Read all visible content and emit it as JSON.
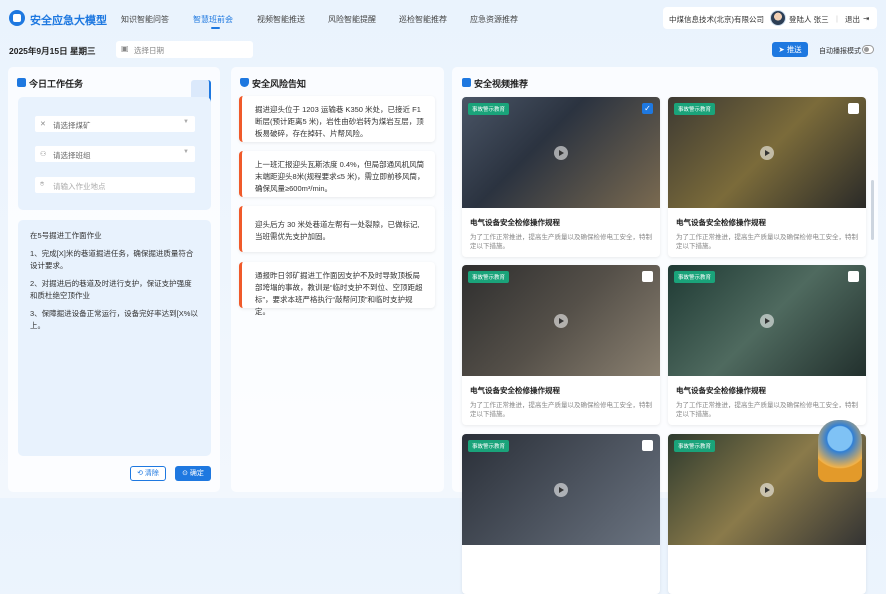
{
  "header": {
    "brand": "安全应急大模型",
    "nav": [
      "知识智能问答",
      "智慧班前会",
      "视频智能推送",
      "风险智能提醒",
      "巡检智能推荐",
      "应急资源推荐"
    ],
    "active_index": 1,
    "company": "中煤信息技术(北京)有限公司",
    "user": "登陆人 张三",
    "logout": "退出"
  },
  "toolbar": {
    "date": "2025年9月15日 星期三",
    "date_placeholder": "选择日期",
    "push_label": "推送",
    "auto_label": "自动播报模式"
  },
  "tasks": {
    "title": "今日工作任务",
    "mine_placeholder": "请选择煤矿",
    "team_placeholder": "请选择班组",
    "location_placeholder": "请输入作业地点",
    "lines": [
      "在5号掘进工作面作业",
      "1、完成[X]米的巷道掘进任务，确保掘进质量符合设计要求。",
      "2、对掘进后的巷道及时进行支护，保证支护强度和质杜绝空顶作业",
      "3、保障掘进设备正常运行，设备完好率达到[X%以上。"
    ],
    "clear_label": "清除",
    "confirm_label": "确定"
  },
  "risks": {
    "title": "安全风险告知",
    "items": [
      "掘进迎头位于 1203 运输巷 K350 米处，已接近 F1断层(预计距离5 米)，岩性由砂岩转为煤岩互层，顶板易破碎，存在掉矸、片帮风险。",
      "上一班汇报迎头瓦斯浓度 0.4%，但局部通风机风筒末端距迎头8米(规程要求≤5 米)，需立即前移风筒，确保风量≥600m³/min。",
      "迎头后方 30 米处巷道左帮有一处裂隙，已做标记,当班需优先支护加固。",
      "通报昨日邻矿掘进工作面因支护不及时导致顶板局部垮塌的事故，教训是“临时支护不到位、空顶距超标”，要求本班严格执行“敲帮问顶”和临时支护规定。"
    ]
  },
  "videos": {
    "title": "安全视频推荐",
    "items": [
      {
        "badge": "事故警示教育",
        "title": "电气设备安全检修操作规程",
        "desc": "为了工作正常推进，提高生产质量以及确保检修电工安全，特制定以下措施。",
        "checked": true
      },
      {
        "badge": "事故警示教育",
        "title": "电气设备安全检修操作规程",
        "desc": "为了工作正常推进，提高生产质量以及确保检修电工安全，特制定以下措施。",
        "checked": false
      },
      {
        "badge": "事故警示教育",
        "title": "电气设备安全检修操作规程",
        "desc": "为了工作正常推进，提高生产质量以及确保检修电工安全，特制定以下措施。",
        "checked": false
      },
      {
        "badge": "事故警示教育",
        "title": "电气设备安全检修操作规程",
        "desc": "为了工作正常推进，提高生产质量以及确保检修电工安全，特制定以下措施。",
        "checked": false
      },
      {
        "badge": "事故警示教育",
        "checked": false
      },
      {
        "badge": "事故警示教育",
        "checked": false
      }
    ]
  }
}
